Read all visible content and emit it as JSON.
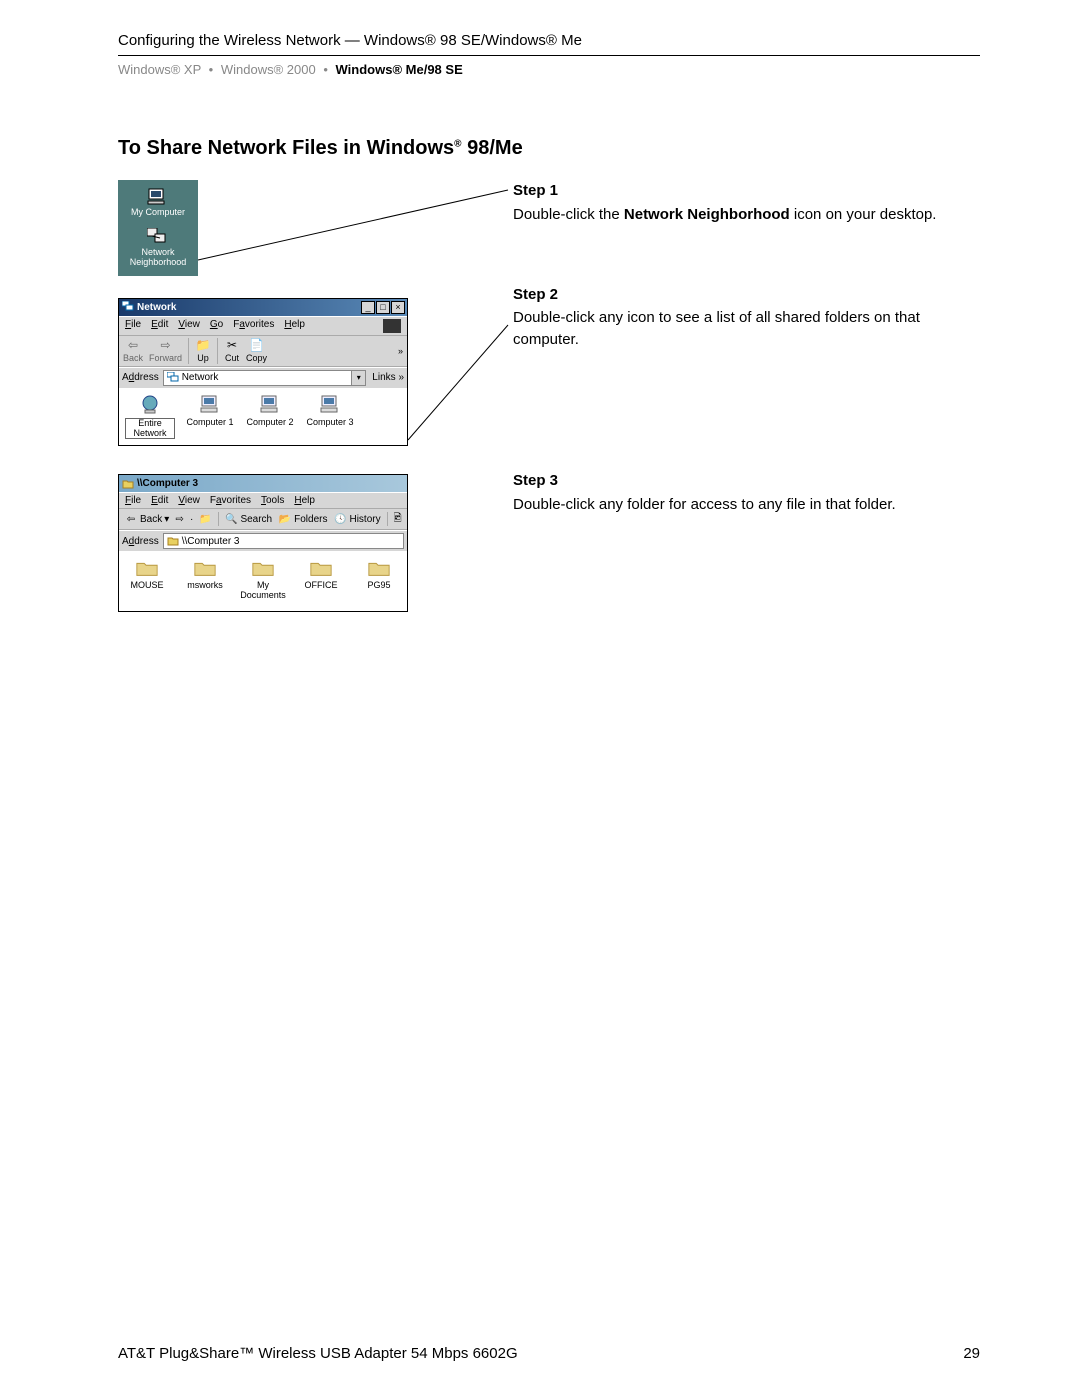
{
  "header": {
    "line": "Configuring the Wireless Network — Windows® 98 SE/Windows® Me",
    "sub_a": "Windows® XP",
    "sub_b": "Windows® 2000",
    "sub_c": "Windows® Me/98 SE"
  },
  "title_pre": "To Share Network Files in Windows",
  "title_reg": "®",
  "title_post": " 98/Me",
  "steps": {
    "s1_label": "Step 1",
    "s1_text_a": "Double-click the ",
    "s1_bold": "Network Neighborhood",
    "s1_text_b": " icon on your desktop.",
    "s2_label": "Step 2",
    "s2_text": "Double-click any icon to see a list of all shared folders on that computer.",
    "s3_label": "Step 3",
    "s3_text": "Double-click any folder for access to any file in that folder."
  },
  "desktop": {
    "icon1": "My Computer",
    "icon2": "Network Neighborhood"
  },
  "win_net": {
    "title": "Network",
    "menu": {
      "file": "File",
      "edit": "Edit",
      "view": "View",
      "go": "Go",
      "fav": "Favorites",
      "help": "Help"
    },
    "tools": {
      "back": "Back",
      "forward": "Forward",
      "up": "Up",
      "cut": "Cut",
      "copy": "Copy"
    },
    "address_label": "Address",
    "address_value": "Network",
    "links": "Links",
    "items": {
      "entire": "Entire Network",
      "c1": "Computer 1",
      "c2": "Computer 2",
      "c3": "Computer 3"
    }
  },
  "win_comp": {
    "title": "\\\\Computer 3",
    "menu": {
      "file": "File",
      "edit": "Edit",
      "view": "View",
      "fav": "Favorites",
      "tools": "Tools",
      "help": "Help"
    },
    "tools": {
      "back": "Back",
      "search": "Search",
      "folders": "Folders",
      "history": "History"
    },
    "address_label": "Address",
    "address_value": "\\\\Computer 3",
    "items": {
      "f1": "MOUSE",
      "f2": "msworks",
      "f3": "My Documents",
      "f4": "OFFICE",
      "f5": "PG95"
    }
  },
  "footer": {
    "left": "AT&T Plug&Share™ Wireless USB Adapter 54 Mbps 6602G",
    "right": "29"
  }
}
